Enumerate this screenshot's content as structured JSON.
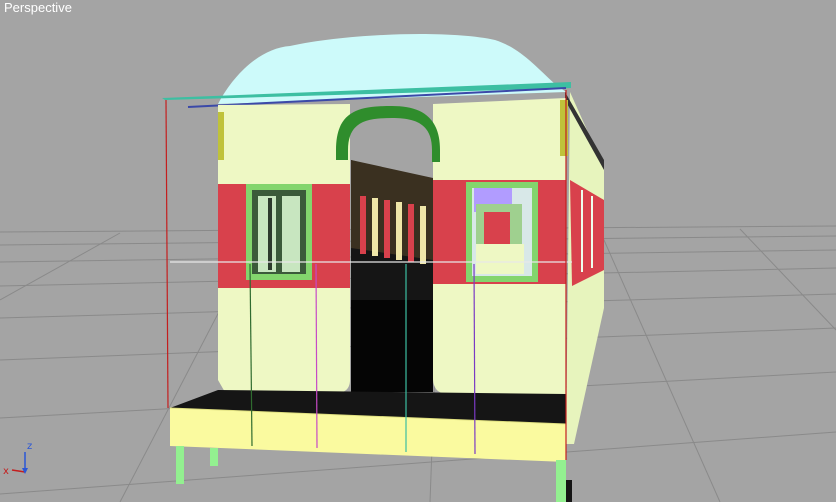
{
  "viewport": {
    "label": "Perspective",
    "background_color": "#a4a4a4",
    "grid_color": "#8a8a8a"
  },
  "gizmo": {
    "axes": [
      {
        "label": "z",
        "color": "#2a56d6"
      },
      {
        "label": "x",
        "color": "#c41e1e"
      }
    ]
  },
  "model": {
    "name": "railway-carriage",
    "colors": {
      "roof": "#cdfafa",
      "body": "#eef8c4",
      "red_panel": "#d8414c",
      "arch": "#2f8d2c",
      "platform": "#fafa9f",
      "legs": "#93f090",
      "interior": "#1a1a1a",
      "window_frame": "#83d56d",
      "selection_cyan": "#3dbfa2"
    }
  }
}
